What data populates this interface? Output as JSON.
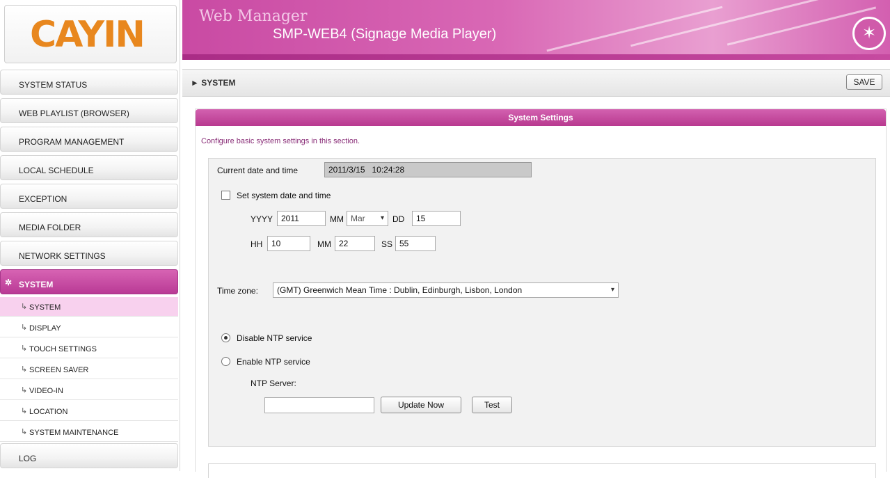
{
  "brand": {
    "logo": "CAYIN"
  },
  "header": {
    "title": "Web Manager",
    "subtitle": "SMP-WEB4 (Signage Media Player)",
    "icon": "magic-wand-icon"
  },
  "sidebar": {
    "items": [
      {
        "label": "SYSTEM STATUS"
      },
      {
        "label": "WEB PLAYLIST (BROWSER)"
      },
      {
        "label": "PROGRAM MANAGEMENT"
      },
      {
        "label": "LOCAL SCHEDULE"
      },
      {
        "label": "EXCEPTION"
      },
      {
        "label": "MEDIA FOLDER"
      },
      {
        "label": "NETWORK SETTINGS"
      },
      {
        "label": "SYSTEM"
      },
      {
        "label": "LOG"
      }
    ],
    "submenu": [
      {
        "label": "SYSTEM"
      },
      {
        "label": "DISPLAY"
      },
      {
        "label": "TOUCH SETTINGS"
      },
      {
        "label": "SCREEN SAVER"
      },
      {
        "label": "VIDEO-IN"
      },
      {
        "label": "LOCATION"
      },
      {
        "label": "SYSTEM MAINTENANCE"
      }
    ],
    "active_icon": "sparkle-icon"
  },
  "breadcrumb": {
    "text": "► SYSTEM"
  },
  "toolbar": {
    "save_label": "SAVE"
  },
  "panel": {
    "title": "System Settings",
    "description": "Configure basic system settings in this section."
  },
  "form": {
    "current_label": "Current date and time",
    "current_value": "2011/3/15   10:24:28",
    "set_label": "Set system date and time",
    "yyyy_label": "YYYY",
    "yyyy_value": "2011",
    "mm_label": "MM",
    "month_value": "Mar",
    "dd_label": "DD",
    "dd_value": "15",
    "hh_label": "HH",
    "hh_value": "10",
    "min_label": "MM",
    "min_value": "22",
    "ss_label": "SS",
    "ss_value": "55",
    "timezone_label": "Time zone:",
    "timezone_value": "(GMT) Greenwich Mean Time : Dublin, Edinburgh, Lisbon, London",
    "ntp_disable_label": "Disable NTP service",
    "ntp_enable_label": "Enable NTP service",
    "ntp_server_label": "NTP Server:",
    "ntp_server_value": "",
    "update_now_label": "Update Now",
    "test_label": "Test"
  },
  "colors": {
    "accent": "#c4449f",
    "accent_light": "#f8d1ee",
    "logo_orange": "#e8871e"
  }
}
